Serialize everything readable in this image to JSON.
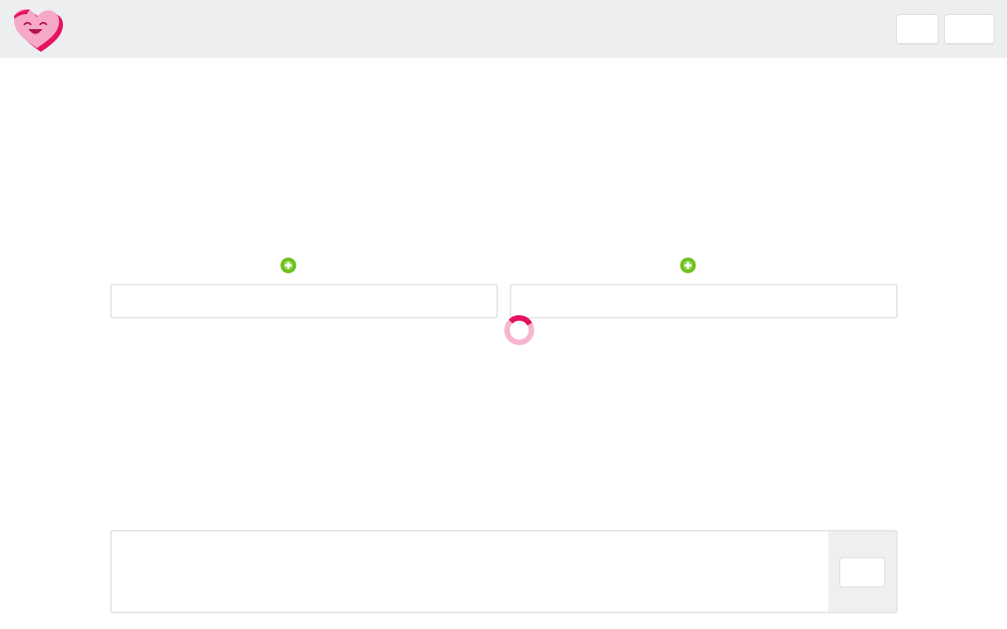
{
  "header": {
    "logo_icon": "heart-mascot-logo",
    "buttons": [
      {
        "label": ""
      },
      {
        "label": ""
      }
    ]
  },
  "left_panel": {
    "add_icon": "plus-circle-icon",
    "input_value": "",
    "input_placeholder": ""
  },
  "right_panel": {
    "add_icon": "plus-circle-icon",
    "input_value": "",
    "input_placeholder": ""
  },
  "loading": {
    "icon": "loading-spinner-icon"
  },
  "composer": {
    "text": "",
    "placeholder": "",
    "send_label": ""
  },
  "colors": {
    "accent": "#e3125f",
    "accent_light": "#f7b6cf",
    "add_green": "#6fc21e",
    "header_bg": "#edeef0"
  }
}
